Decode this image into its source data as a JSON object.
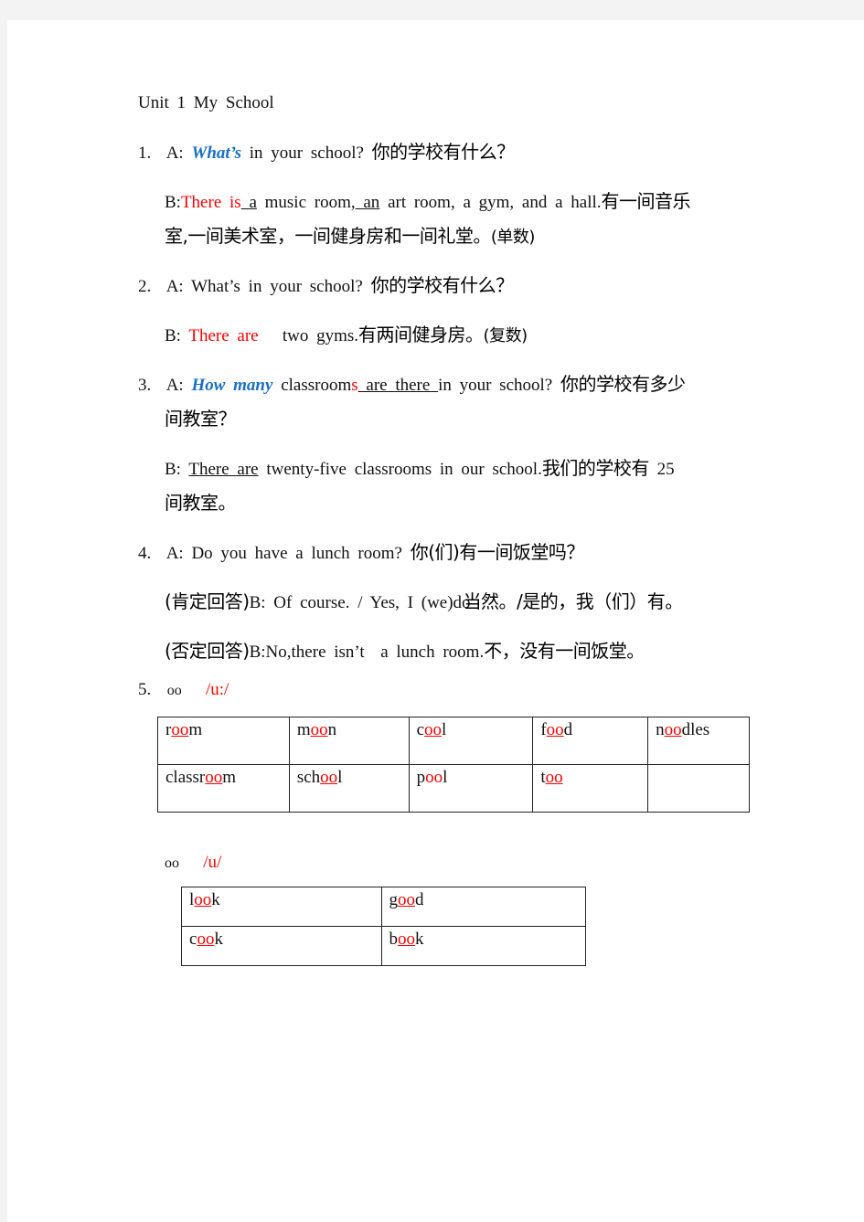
{
  "title": "Unit 1 My School",
  "section1": {
    "num": "1.",
    "a_prefix": "A: ",
    "a_highlight": "What’s",
    "a_rest": " in your school? ",
    "a_cn": "你的学校有什么？",
    "b_prefix": "B:",
    "b_red": "There is",
    "b_blank1": " a",
    "b_mid": " music room,",
    "b_blank2": " an",
    "b_rest": " art room, a gym, and a hall.",
    "b_cn1": "有一间音乐",
    "b_cn2": "室,一间美术室，一间健身房和一间礼堂。",
    "b_note": "(单数)"
  },
  "section2": {
    "num": "2.",
    "a_text": "A: What’s in your school? ",
    "a_cn": "你的学校有什么？",
    "b_prefix": "B: ",
    "b_red": "There are",
    "b_rest": "   two gyms.",
    "b_cn": "有两间健身房。",
    "b_note": "(复数)"
  },
  "section3": {
    "num": "3.",
    "a_prefix": "A: ",
    "a_highlight": "How many",
    "a_word": " classroom",
    "a_red_s": "s",
    "a_blank": " are there ",
    "a_rest": "in your school? ",
    "a_cn1": "你的学校有多少",
    "a_cn2": "间教室？",
    "b_prefix": "B: ",
    "b_blank": "There are",
    "b_rest": " twenty-five classrooms in our school.",
    "b_cn1": "我们的学校有",
    "b_num": " 25",
    "b_cn2": "间教室。"
  },
  "section4": {
    "num": "4.",
    "a_text": "A: Do you have a lunch room? ",
    "a_cn": "你(们)有一间饭堂吗？",
    "pos_label": "(肯定回答)",
    "pos_text": "B: Of course. / Yes, I (we)do",
    "pos_cn": "当然。/是的，我（们）有。",
    "neg_label": "(否定回答)",
    "neg_text": "B:No,there isn’t  a lunch room.",
    "neg_cn": "不，没有一间饭堂。"
  },
  "section5": {
    "num": "5.",
    "long": {
      "letters": "oo",
      "sound": "/u:/",
      "rows": [
        [
          {
            "pre": "r",
            "oo": "oo",
            "post": "m",
            "underline": true
          },
          {
            "pre": "m",
            "oo": "oo",
            "post": "n",
            "underline": true
          },
          {
            "pre": "c",
            "oo": "oo",
            "post": "l",
            "underline": true
          },
          {
            "pre": "f",
            "oo": "oo",
            "post": "d",
            "underline": true
          },
          {
            "pre": "n",
            "oo": "oo",
            "post": "dles",
            "underline": true
          }
        ],
        [
          {
            "pre": "classr",
            "oo": "oo",
            "post": "m",
            "underline": true
          },
          {
            "pre": "sch",
            "oo": "oo",
            "post": "l",
            "underline": true
          },
          {
            "pre": "p",
            "oo": "oo",
            "post": "l",
            "underline": false
          },
          {
            "pre": "t",
            "oo": "oo",
            "post": "",
            "underline": true
          },
          {
            "pre": "",
            "oo": "",
            "post": "",
            "underline": false
          }
        ]
      ]
    },
    "short": {
      "letters": "oo",
      "sound": "/u/",
      "rows": [
        [
          {
            "pre": "l",
            "oo": "oo",
            "post": "k",
            "underline": true
          },
          {
            "pre": "g",
            "oo": "oo",
            "post": "d",
            "underline": true
          }
        ],
        [
          {
            "pre": "c",
            "oo": "oo",
            "post": "k",
            "underline": true
          },
          {
            "pre": "b",
            "oo": "oo",
            "post": "k",
            "underline": true
          }
        ]
      ]
    }
  }
}
